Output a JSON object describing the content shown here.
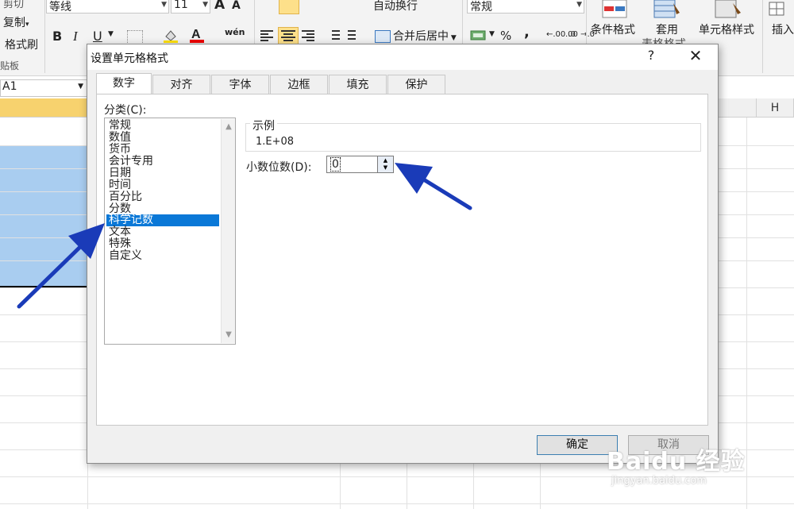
{
  "ribbon": {
    "clipboard_cut": "剪切",
    "clipboard_copy": "复制",
    "clipboard_copy_arrow": "▾",
    "clipboard_painter": "格式刷",
    "clipboard_group": "贴板",
    "font_name": "等线",
    "font_size": "11",
    "font_grow": "A",
    "font_shrink": "A",
    "bold": "B",
    "italic": "I",
    "underline": "U",
    "phonetic": "wén",
    "wrap_text": "自动换行",
    "merge_center": "合并后居中",
    "number_format": "常规",
    "percent": "%",
    "comma": ",",
    "increase_decimal": "←.00 .0",
    "decrease_decimal": ".00 →.0",
    "conditional_format": "条件格式",
    "format_table": "套用\n表格格式",
    "cell_styles": "单元格样式",
    "insert": "插入"
  },
  "namebox": {
    "value": "A1"
  },
  "sheet": {
    "col_h": "H"
  },
  "dialog": {
    "title": "设置单元格格式",
    "help": "?",
    "close": "✕",
    "tabs": [
      "数字",
      "对齐",
      "字体",
      "边框",
      "填充",
      "保护"
    ],
    "category_label": "分类(C):",
    "categories": [
      "常规",
      "数值",
      "货币",
      "会计专用",
      "日期",
      "时间",
      "百分比",
      "分数",
      "科学记数",
      "文本",
      "特殊",
      "自定义"
    ],
    "selected_category": "科学记数",
    "sample_label": "示例",
    "sample_value": "1.E+08",
    "decimal_label": "小数位数(D):",
    "decimal_value": "0",
    "ok": "确定",
    "cancel": "取消"
  },
  "watermark": {
    "main": "Baidu 经验",
    "sub": "jingyan.baidu.com"
  },
  "colors": {
    "selection": "#0a78d7",
    "arrow": "#1a3bb8",
    "cell_fill": "#a9cdf0",
    "header_active": "#f7d26e"
  }
}
